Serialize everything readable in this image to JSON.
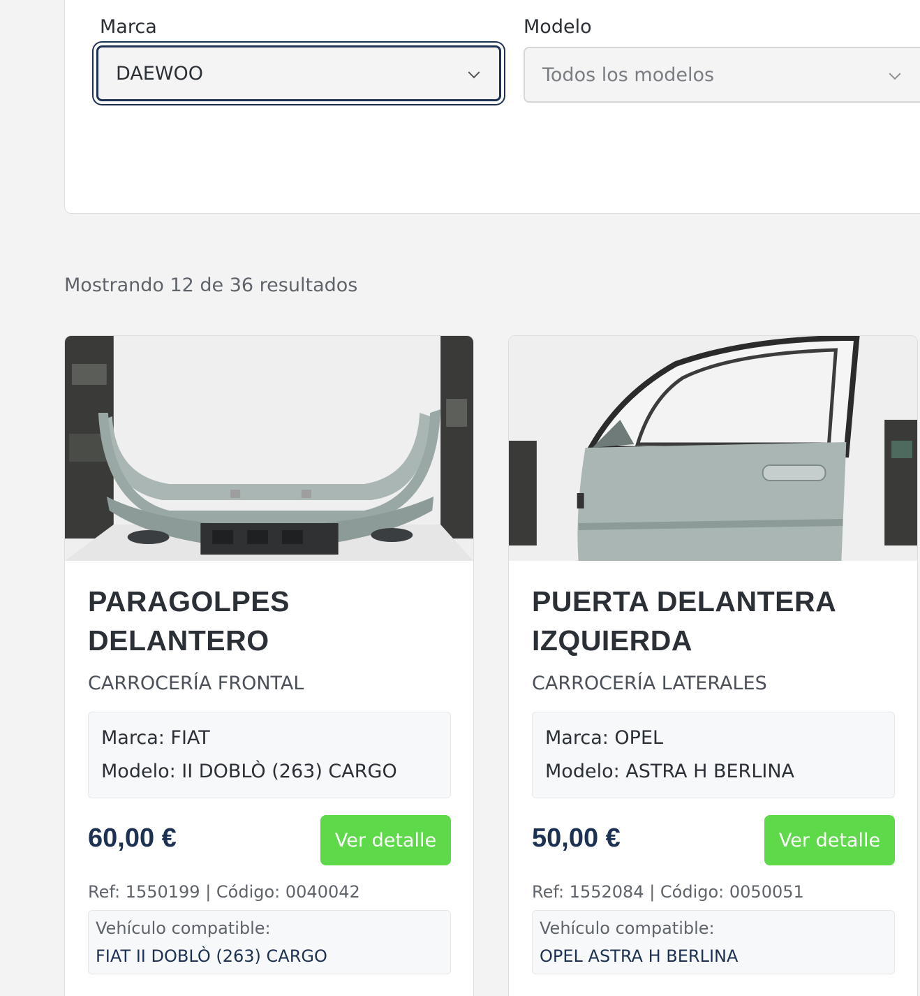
{
  "filters": {
    "brand_label": "Marca",
    "brand_value": "DAEWOO",
    "model_label": "Modelo",
    "model_value": "Todos los modelos"
  },
  "results": {
    "count_text": "Mostrando 12 de 36 resultados"
  },
  "products": [
    {
      "title": "PARAGOLPES DELANTERO",
      "category": "CARROCERÍA FRONTAL",
      "brand": "Marca: FIAT",
      "model": "Modelo: II DOBLÒ (263) CARGO",
      "price": "60,00 €",
      "button": "Ver detalle",
      "ref": "Ref: 1550199 | Código: 0040042",
      "compat_label": "Vehículo compatible:",
      "compat_value": "FIAT II DOBLÒ (263) CARGO"
    },
    {
      "title": "PUERTA DELANTERA IZQUIERDA",
      "category": "CARROCERÍA LATERALES",
      "brand": "Marca: OPEL",
      "model": "Modelo: ASTRA H BERLINA",
      "price": "50,00 €",
      "button": "Ver detalle",
      "ref": "Ref: 1552084 | Código: 0050051",
      "compat_label": "Vehículo compatible:",
      "compat_value": "OPEL ASTRA H BERLINA"
    }
  ],
  "colors": {
    "accent_navy": "#1d3153",
    "button_green": "#5ed94a"
  }
}
